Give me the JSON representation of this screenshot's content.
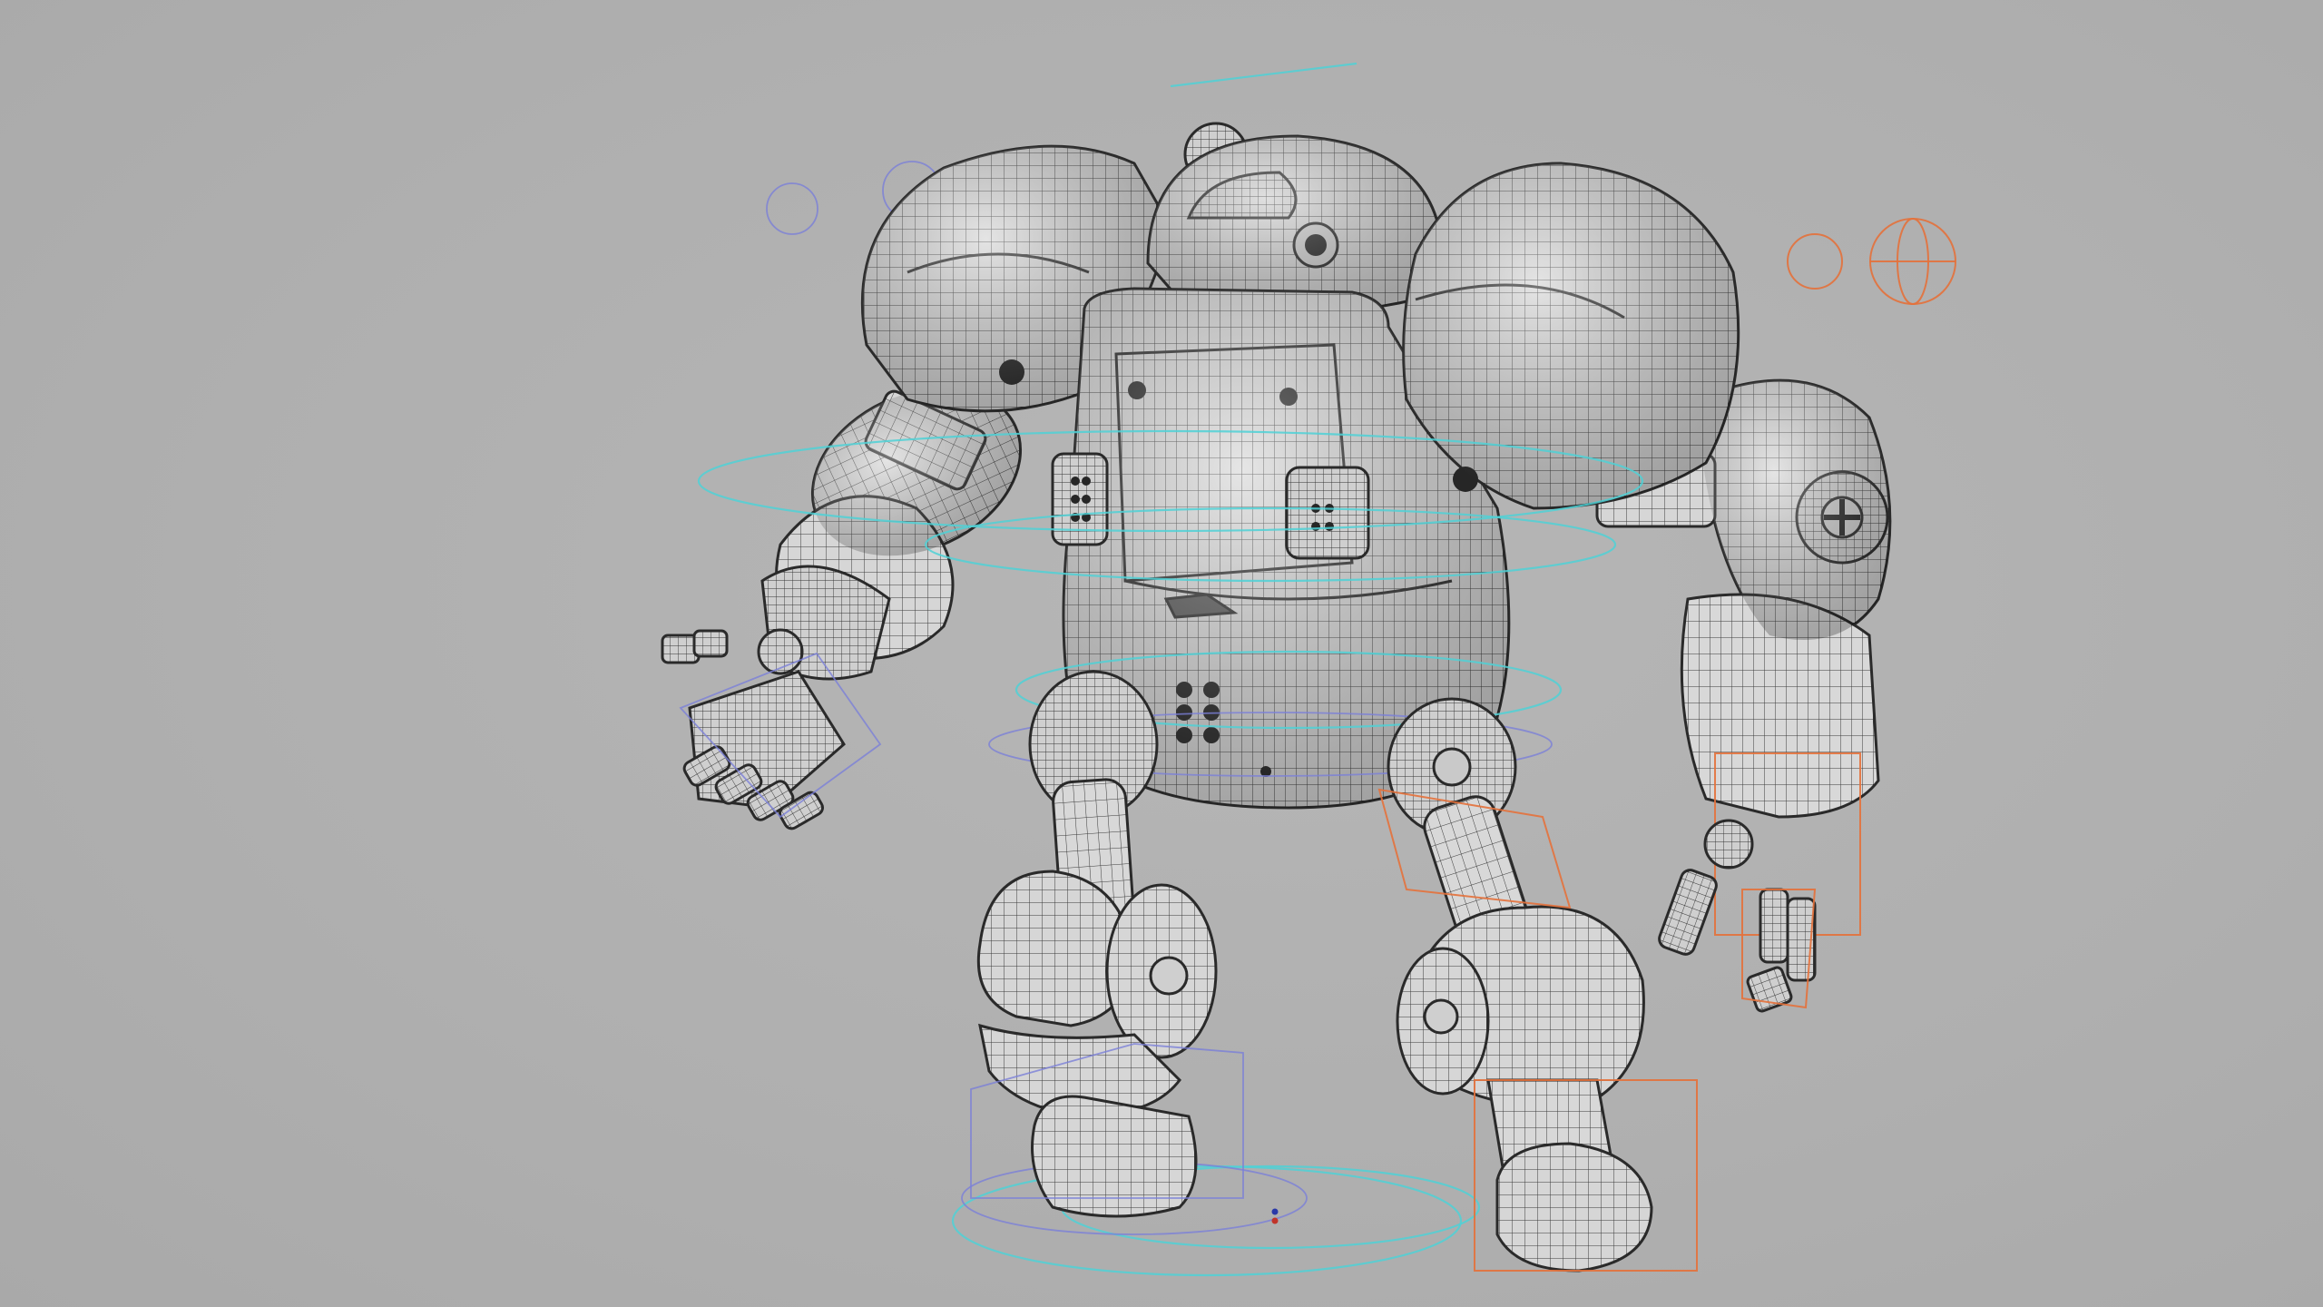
{
  "viewport": {
    "background_color": "#b0b0b0",
    "wireframe_color": "#2a2a2a",
    "mesh_fill_color": "#d4d4d4",
    "rig_colors": {
      "cyan": "#4fd1d6",
      "blue": "#7a80d8",
      "orange": "#e4713b"
    }
  },
  "model": {
    "icon": "robot-wireframe-icon"
  }
}
